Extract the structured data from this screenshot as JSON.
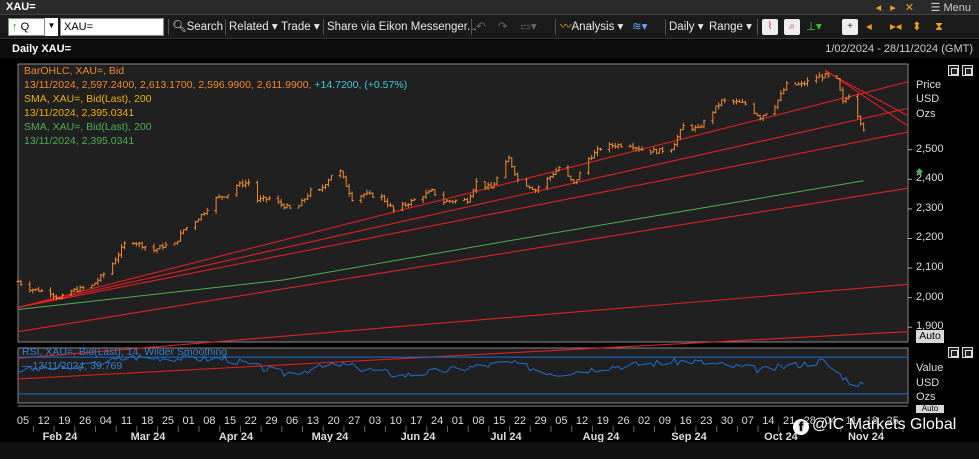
{
  "window": {
    "title": "XAU=",
    "menu_label": "Menu",
    "nav_arrows": "◂ ▸ ✕"
  },
  "toolbar": {
    "symbol_field": "Q",
    "ric_value": "XAU=",
    "search_label": "Search",
    "related_label": "Related",
    "trade_label": "Trade",
    "share_label": "Share via Eikon Messenger...",
    "analysis_label": "Analysis",
    "interval_label": "Daily",
    "range_label": "Range"
  },
  "chart_header": {
    "title": "Daily XAU=",
    "date_range": "1/02/2024 - 28/11/2024 (GMT)"
  },
  "legend": {
    "line1": "BarOHLC, XAU=, Bid",
    "line2": "13/11/2024, 2,597.2400, 2,613.1700, 2,596.9900, 2,611.9900, ",
    "line2_change": "+14.7200, (+0.57%)",
    "line3": "SMA, XAU=, Bid(Last),  200",
    "line4": "13/11/2024, 2,395.0341",
    "line5": "SMA, XAU=, Bid(Last),  200",
    "line6": "13/11/2024, 2,395.0341",
    "rsi1": "RSI, XAU=, Bid(Last),  14, Wilder Smoothing",
    "rsi2": "13/11/2024, 39.769"
  },
  "price_axis": {
    "title": "Price",
    "currency": "USD",
    "unit": "Ozs",
    "ticks": [
      "2,500",
      "2,400",
      "2,300",
      "2,200",
      "2,100",
      "2,000",
      "1,900"
    ],
    "auto_label": "Auto",
    "current_marker": "2,400"
  },
  "rsi_axis": {
    "title": "Value",
    "currency": "USD",
    "unit": "Ozs",
    "auto_label": "Auto"
  },
  "x_axis": {
    "days": [
      "05",
      "12",
      "19",
      "26",
      "04",
      "11",
      "18",
      "25",
      "01",
      "08",
      "15",
      "22",
      "29",
      "06",
      "13",
      "20",
      "27",
      "03",
      "10",
      "17",
      "24",
      "01",
      "08",
      "15",
      "22",
      "29",
      "05",
      "12",
      "19",
      "26",
      "02",
      "09",
      "16",
      "23",
      "30",
      "07",
      "14",
      "21",
      "28",
      "04",
      "11",
      "18",
      "25"
    ],
    "months": [
      "Feb 24",
      "Mar 24",
      "Apr 24",
      "May 24",
      "Jun 24",
      "Jul 24",
      "Aug 24",
      "Sep 24",
      "Oct 24",
      "Nov 24"
    ]
  },
  "watermark": "@IC Markets Global",
  "colors": {
    "bars": "#f08a30",
    "sma": "#4caf50",
    "trend": "#e02020",
    "rsi": "#1e6fd0",
    "legend_orange": "#f08a30",
    "legend_gold": "#e8b000",
    "legend_green": "#4caf50",
    "legend_cyan": "#40c8e0",
    "rsi_legend": "#3a7fd0"
  },
  "chart_data": [
    {
      "type": "ohlc",
      "title": "Daily XAU=",
      "series_name": "BarOHLC, XAU=, Bid",
      "ylabel": "Price USD Ozs",
      "ylim": [
        1850,
        2790
      ],
      "x_start": "2024-02-01",
      "x_end": "2024-11-28",
      "weekly_close_points": [
        [
          "2024-02-01",
          2055
        ],
        [
          "2024-02-05",
          2030
        ],
        [
          "2024-02-12",
          2018
        ],
        [
          "2024-02-15",
          1995
        ],
        [
          "2024-02-19",
          2022
        ],
        [
          "2024-02-26",
          2040
        ],
        [
          "2024-03-01",
          2080
        ],
        [
          "2024-03-04",
          2115
        ],
        [
          "2024-03-08",
          2180
        ],
        [
          "2024-03-11",
          2190
        ],
        [
          "2024-03-18",
          2160
        ],
        [
          "2024-03-21",
          2175
        ],
        [
          "2024-03-25",
          2180
        ],
        [
          "2024-03-28",
          2230
        ],
        [
          "2024-04-01",
          2260
        ],
        [
          "2024-04-04",
          2290
        ],
        [
          "2024-04-08",
          2335
        ],
        [
          "2024-04-12",
          2350
        ],
        [
          "2024-04-15",
          2380
        ],
        [
          "2024-04-19",
          2390
        ],
        [
          "2024-04-22",
          2330
        ],
        [
          "2024-04-26",
          2335
        ],
        [
          "2024-04-29",
          2320
        ],
        [
          "2024-05-03",
          2300
        ],
        [
          "2024-05-06",
          2310
        ],
        [
          "2024-05-10",
          2360
        ],
        [
          "2024-05-13",
          2360
        ],
        [
          "2024-05-17",
          2415
        ],
        [
          "2024-05-20",
          2425
        ],
        [
          "2024-05-24",
          2335
        ],
        [
          "2024-05-28",
          2350
        ],
        [
          "2024-06-03",
          2340
        ],
        [
          "2024-06-07",
          2295
        ],
        [
          "2024-06-11",
          2315
        ],
        [
          "2024-06-14",
          2330
        ],
        [
          "2024-06-20",
          2360
        ],
        [
          "2024-06-24",
          2325
        ],
        [
          "2024-06-28",
          2328
        ],
        [
          "2024-07-02",
          2330
        ],
        [
          "2024-07-05",
          2390
        ],
        [
          "2024-07-10",
          2370
        ],
        [
          "2024-07-16",
          2470
        ],
        [
          "2024-07-19",
          2400
        ],
        [
          "2024-07-25",
          2365
        ],
        [
          "2024-07-30",
          2410
        ],
        [
          "2024-08-02",
          2440
        ],
        [
          "2024-08-07",
          2385
        ],
        [
          "2024-08-12",
          2470
        ],
        [
          "2024-08-16",
          2505
        ],
        [
          "2024-08-20",
          2515
        ],
        [
          "2024-08-26",
          2518
        ],
        [
          "2024-08-30",
          2500
        ],
        [
          "2024-09-04",
          2495
        ],
        [
          "2024-09-09",
          2505
        ],
        [
          "2024-09-13",
          2580
        ],
        [
          "2024-09-18",
          2570
        ],
        [
          "2024-09-23",
          2630
        ],
        [
          "2024-09-26",
          2665
        ],
        [
          "2024-10-01",
          2660
        ],
        [
          "2024-10-04",
          2655
        ],
        [
          "2024-10-09",
          2610
        ],
        [
          "2024-10-14",
          2650
        ],
        [
          "2024-10-18",
          2720
        ],
        [
          "2024-10-23",
          2720
        ],
        [
          "2024-10-28",
          2745
        ],
        [
          "2024-10-31",
          2750
        ],
        [
          "2024-11-04",
          2735
        ],
        [
          "2024-11-06",
          2660
        ],
        [
          "2024-11-08",
          2685
        ],
        [
          "2024-11-11",
          2618
        ],
        [
          "2024-11-13",
          2572
        ]
      ],
      "sma200": [
        [
          "2024-02-01",
          1960
        ],
        [
          "2024-05-01",
          2060
        ],
        [
          "2024-08-01",
          2220
        ],
        [
          "2024-11-13",
          2395
        ]
      ],
      "trendlines": [
        [
          [
            "2024-02-01",
            1967
          ],
          [
            "2024-11-28",
            2640
          ]
        ],
        [
          [
            "2024-02-01",
            1967
          ],
          [
            "2024-11-28",
            2560
          ]
        ],
        [
          [
            "2024-02-01",
            1885
          ],
          [
            "2024-11-28",
            2370
          ]
        ],
        [
          [
            "2024-02-01",
            1967
          ],
          [
            "2024-11-28",
            2730
          ]
        ],
        [
          [
            "2024-02-01",
            1795
          ],
          [
            "2024-11-28",
            2045
          ]
        ],
        [
          [
            "2024-02-01",
            1725
          ],
          [
            "2024-11-28",
            1885
          ]
        ],
        [
          [
            "2024-10-31",
            2770
          ],
          [
            "2024-11-28",
            2580
          ]
        ],
        [
          [
            "2024-10-31",
            2765
          ],
          [
            "2024-11-28",
            2615
          ]
        ]
      ],
      "last_bar": {
        "date": "2024-11-13",
        "open": 2597.24,
        "high": 2613.17,
        "low": 2596.99,
        "close": 2611.99,
        "change": 14.72,
        "change_pct": 0.57
      }
    },
    {
      "type": "line",
      "title": "RSI",
      "series_name": "RSI, XAU=, Bid(Last), 14, Wilder Smoothing",
      "ylim": [
        20,
        80
      ],
      "reference_lines": [
        70,
        30
      ],
      "last_value": 39.769,
      "points": [
        [
          "2024-02-01",
          56
        ],
        [
          "2024-02-20",
          58
        ],
        [
          "2024-03-10",
          70
        ],
        [
          "2024-04-12",
          68
        ],
        [
          "2024-05-01",
          52
        ],
        [
          "2024-05-20",
          62
        ],
        [
          "2024-06-10",
          50
        ],
        [
          "2024-07-16",
          64
        ],
        [
          "2024-08-01",
          52
        ],
        [
          "2024-08-20",
          60
        ],
        [
          "2024-09-15",
          66
        ],
        [
          "2024-10-10",
          56
        ],
        [
          "2024-10-30",
          66
        ],
        [
          "2024-11-08",
          44
        ],
        [
          "2024-11-13",
          39.8
        ]
      ]
    }
  ]
}
